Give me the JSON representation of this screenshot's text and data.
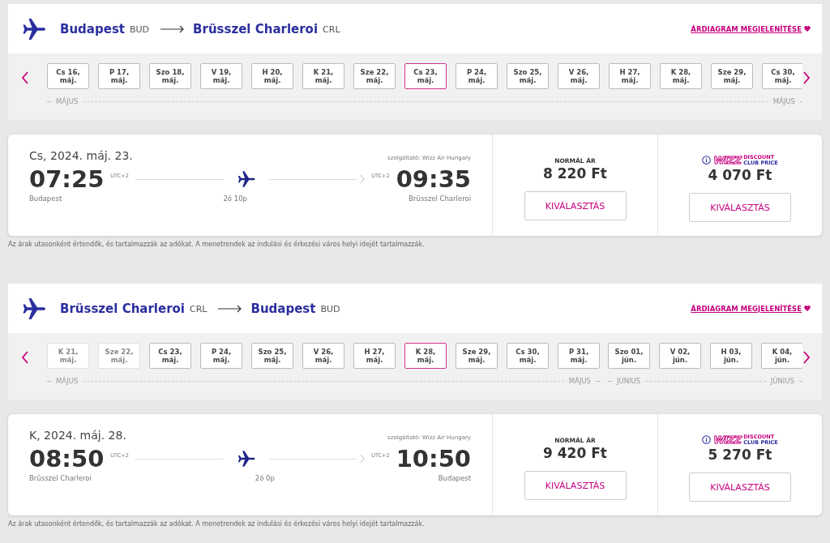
{
  "sections": [
    {
      "origin": {
        "city": "Budapest",
        "code": "BUD"
      },
      "destination": {
        "city": "Brüsszel Charleroi",
        "code": "CRL"
      },
      "chart_link": "ÁRDIAGRAM MEGJELENÍTÉSE",
      "months": [
        {
          "start_label": "MÁJUS",
          "end_label": "MÁJUS",
          "dates": [
            {
              "day": "Cs 16,",
              "month": "máj.",
              "selected": false,
              "disabled": false
            },
            {
              "day": "P 17,",
              "month": "máj.",
              "selected": false,
              "disabled": false
            },
            {
              "day": "Szo 18,",
              "month": "máj.",
              "selected": false,
              "disabled": false
            },
            {
              "day": "V 19,",
              "month": "máj.",
              "selected": false,
              "disabled": false
            },
            {
              "day": "H 20,",
              "month": "máj.",
              "selected": false,
              "disabled": false
            },
            {
              "day": "K 21,",
              "month": "máj.",
              "selected": false,
              "disabled": false
            },
            {
              "day": "Sze 22,",
              "month": "máj.",
              "selected": false,
              "disabled": false
            },
            {
              "day": "Cs 23,",
              "month": "máj.",
              "selected": true,
              "disabled": false
            },
            {
              "day": "P 24,",
              "month": "máj.",
              "selected": false,
              "disabled": false
            },
            {
              "day": "Szo 25,",
              "month": "máj.",
              "selected": false,
              "disabled": false
            },
            {
              "day": "V 26,",
              "month": "máj.",
              "selected": false,
              "disabled": false
            },
            {
              "day": "H 27,",
              "month": "máj.",
              "selected": false,
              "disabled": false
            },
            {
              "day": "K 28,",
              "month": "máj.",
              "selected": false,
              "disabled": false
            },
            {
              "day": "Sze 29,",
              "month": "máj.",
              "selected": false,
              "disabled": false
            },
            {
              "day": "Cs 30,",
              "month": "máj.",
              "selected": false,
              "disabled": false
            }
          ]
        }
      ],
      "flight": {
        "date": "Cs, 2024. máj. 23.",
        "operator": "szolgáltató: Wizz Air Hungary",
        "departure_time": "07:25",
        "departure_tz": "UTC+2",
        "departure_city": "Budapest",
        "arrival_time": "09:35",
        "arrival_tz": "UTC+2",
        "arrival_city": "Brüsszel Charleroi",
        "duration": "2ó 10p",
        "fares": [
          {
            "kind": "normal",
            "label": "NORMÁL ÁR",
            "price": "8 220 Ft",
            "button": "KIVÁLASZTÁS"
          },
          {
            "kind": "club",
            "brand": "WIZZ",
            "line1": "DISCOUNT",
            "line2": "CLUB PRICE",
            "price": "4 070 Ft",
            "button": "KIVÁLASZTÁS"
          }
        ]
      },
      "note": "Az árak utasonként értendők, és tartalmazzák az adókat. A menetrendek az indulási és érkezési város helyi idejét tartalmazzák."
    },
    {
      "origin": {
        "city": "Brüsszel Charleroi",
        "code": "CRL"
      },
      "destination": {
        "city": "Budapest",
        "code": "BUD"
      },
      "chart_link": "ÁRDIAGRAM MEGJELENÍTÉSE",
      "months": [
        {
          "start_label": "MÁJUS",
          "end_label": "MÁJUS",
          "dates": [
            {
              "day": "K 21,",
              "month": "máj.",
              "selected": false,
              "disabled": true
            },
            {
              "day": "Sze 22,",
              "month": "máj.",
              "selected": false,
              "disabled": true
            },
            {
              "day": "Cs 23,",
              "month": "máj.",
              "selected": false,
              "disabled": false
            },
            {
              "day": "P 24,",
              "month": "máj.",
              "selected": false,
              "disabled": false
            },
            {
              "day": "Szo 25,",
              "month": "máj.",
              "selected": false,
              "disabled": false
            },
            {
              "day": "V 26,",
              "month": "máj.",
              "selected": false,
              "disabled": false
            },
            {
              "day": "H 27,",
              "month": "máj.",
              "selected": false,
              "disabled": false
            },
            {
              "day": "K 28,",
              "month": "máj.",
              "selected": true,
              "disabled": false
            },
            {
              "day": "Sze 29,",
              "month": "máj.",
              "selected": false,
              "disabled": false
            },
            {
              "day": "Cs 30,",
              "month": "máj.",
              "selected": false,
              "disabled": false
            },
            {
              "day": "P 31,",
              "month": "máj.",
              "selected": false,
              "disabled": false
            }
          ]
        },
        {
          "start_label": "JÚNIUS",
          "end_label": "JÚNIUS",
          "dates": [
            {
              "day": "Szo 01,",
              "month": "jún.",
              "selected": false,
              "disabled": false
            },
            {
              "day": "V 02,",
              "month": "jún.",
              "selected": false,
              "disabled": false
            },
            {
              "day": "H 03,",
              "month": "jún.",
              "selected": false,
              "disabled": false
            },
            {
              "day": "K 04,",
              "month": "jún.",
              "selected": false,
              "disabled": false
            }
          ]
        }
      ],
      "flight": {
        "date": "K, 2024. máj. 28.",
        "operator": "szolgáltató: Wizz Air Hungary",
        "departure_time": "08:50",
        "departure_tz": "UTC+2",
        "departure_city": "Brüsszel Charleroi",
        "arrival_time": "10:50",
        "arrival_tz": "UTC+2",
        "arrival_city": "Budapest",
        "duration": "2ó 0p",
        "fares": [
          {
            "kind": "normal",
            "label": "NORMÁL ÁR",
            "price": "9 420 Ft",
            "button": "KIVÁLASZTÁS"
          },
          {
            "kind": "club",
            "brand": "WIZZ",
            "line1": "DISCOUNT",
            "line2": "CLUB PRICE",
            "price": "5 270 Ft",
            "button": "KIVÁLASZTÁS"
          }
        ]
      },
      "note": "Az árak utasonként értendők, és tartalmazzák az adókat. A menetrendek az indulási és érkezési város helyi idejét tartalmazzák."
    }
  ]
}
